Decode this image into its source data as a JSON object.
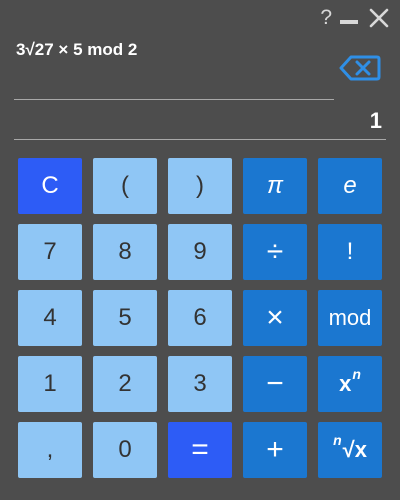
{
  "window_controls": {
    "help": "?",
    "close": "✕"
  },
  "display": {
    "expression": "3√27 × 5 mod 2",
    "result": "1"
  },
  "colors": {
    "background": "#4d4d4d",
    "number_key": "#8fc6f5",
    "operator_key": "#1b77d0",
    "accent_key": "#2d5cf6"
  },
  "keys": {
    "clear": "C",
    "open_paren": "(",
    "close_paren": ")",
    "pi": "π",
    "e": "e",
    "seven": "7",
    "eight": "8",
    "nine": "9",
    "divide": "÷",
    "factorial": "!",
    "four": "4",
    "five": "5",
    "six": "6",
    "multiply": "×",
    "mod": "mod",
    "one": "1",
    "two": "2",
    "three": "3",
    "subtract": "−",
    "power_base": "x",
    "power_exp": "n",
    "comma": ",",
    "zero": "0",
    "equals": "=",
    "add": "+",
    "root_index": "n",
    "root_body": "√x"
  }
}
